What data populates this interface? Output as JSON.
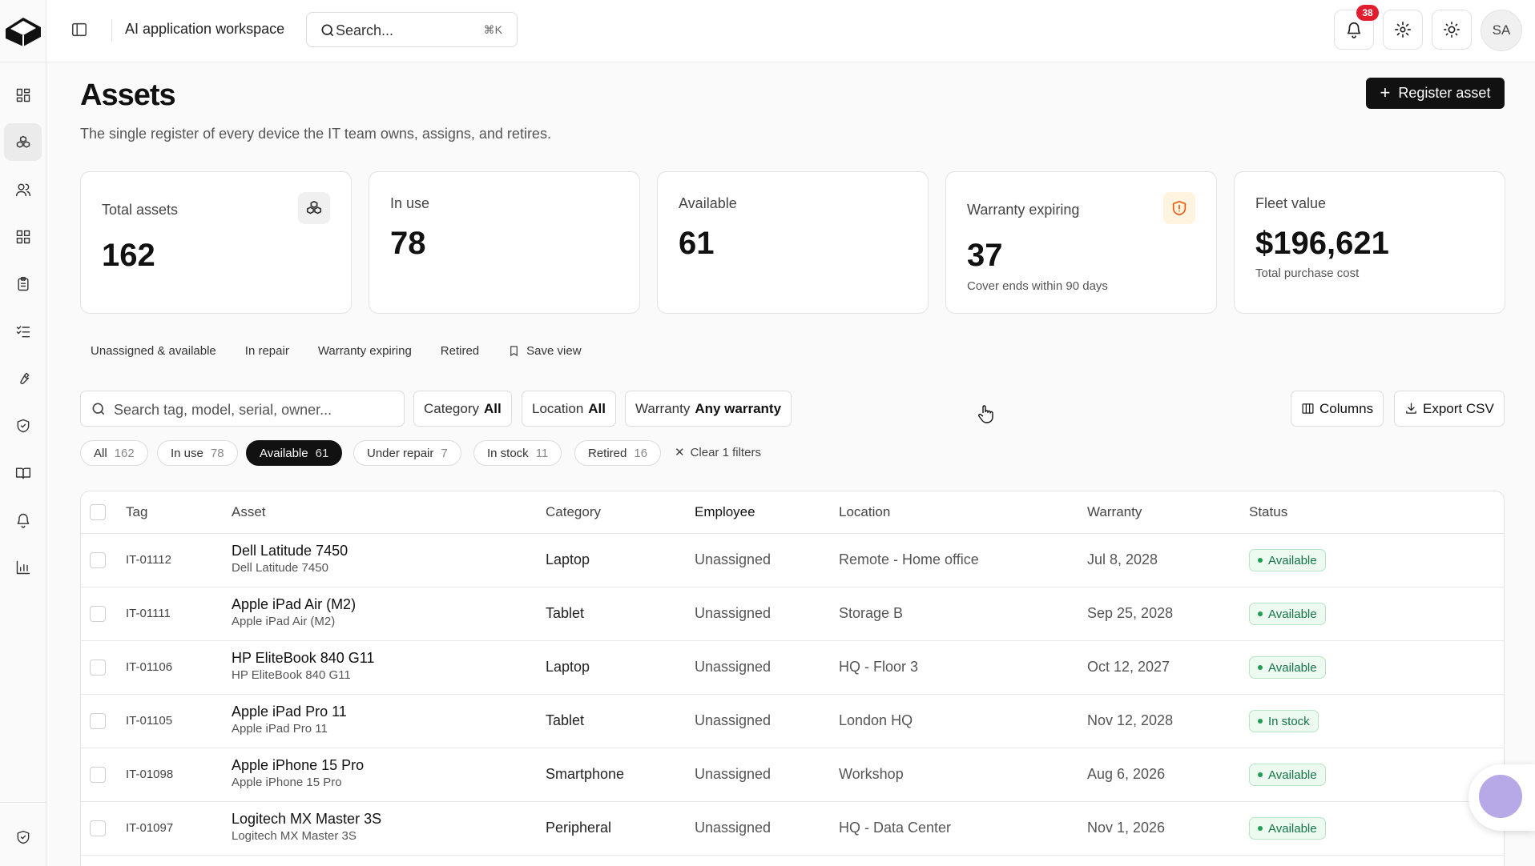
{
  "topbar": {
    "workspace": "AI application workspace",
    "search_placeholder": "Search...",
    "search_shortcut": "⌘K",
    "notification_count": "38",
    "avatar_initials": "SA"
  },
  "header": {
    "title": "Assets",
    "subtitle": "The single register of every device the IT team owns, assigns, and retires.",
    "register_label": "Register asset"
  },
  "stats": {
    "total": {
      "label": "Total assets",
      "value": "162"
    },
    "in_use": {
      "label": "In use",
      "value": "78"
    },
    "available": {
      "label": "Available",
      "value": "61"
    },
    "warranty": {
      "label": "Warranty expiring",
      "value": "37",
      "sub": "Cover ends within 90 days"
    },
    "fleet": {
      "label": "Fleet value",
      "value": "$196,621",
      "sub": "Total purchase cost"
    }
  },
  "views": {
    "unassigned": "Unassigned & available",
    "repair": "In repair",
    "warranty": "Warranty expiring",
    "retired": "Retired",
    "save": "Save view"
  },
  "filters": {
    "search_placeholder": "Search tag, model, serial, owner...",
    "category_label": "Category",
    "category_value": "All",
    "location_label": "Location",
    "location_value": "All",
    "warranty_label": "Warranty",
    "warranty_value": "Any warranty",
    "columns_label": "Columns",
    "export_label": "Export CSV",
    "clear_label": "Clear 1 filters"
  },
  "chips": {
    "all": {
      "label": "All",
      "count": "162"
    },
    "in_use": {
      "label": "In use",
      "count": "78"
    },
    "available": {
      "label": "Available",
      "count": "61"
    },
    "repair": {
      "label": "Under repair",
      "count": "7"
    },
    "stock": {
      "label": "In stock",
      "count": "11"
    },
    "retired": {
      "label": "Retired",
      "count": "16"
    }
  },
  "table": {
    "headers": {
      "tag": "Tag",
      "asset": "Asset",
      "category": "Category",
      "employee": "Employee",
      "location": "Location",
      "warranty": "Warranty",
      "status": "Status"
    },
    "rows": [
      {
        "tag": "IT-01112",
        "name": "Dell Latitude 7450",
        "model": "Dell Latitude 7450",
        "category": "Laptop",
        "employee": "Unassigned",
        "location": "Remote - Home office",
        "warranty": "Jul 8, 2028",
        "status": "Available"
      },
      {
        "tag": "IT-01111",
        "name": "Apple iPad Air (M2)",
        "model": "Apple iPad Air (M2)",
        "category": "Tablet",
        "employee": "Unassigned",
        "location": "Storage B",
        "warranty": "Sep 25, 2028",
        "status": "Available"
      },
      {
        "tag": "IT-01106",
        "name": "HP EliteBook 840 G11",
        "model": "HP EliteBook 840 G11",
        "category": "Laptop",
        "employee": "Unassigned",
        "location": "HQ - Floor 3",
        "warranty": "Oct 12, 2027",
        "status": "Available"
      },
      {
        "tag": "IT-01105",
        "name": "Apple iPad Pro 11",
        "model": "Apple iPad Pro 11",
        "category": "Tablet",
        "employee": "Unassigned",
        "location": "London HQ",
        "warranty": "Nov 12, 2028",
        "status": "In stock"
      },
      {
        "tag": "IT-01098",
        "name": "Apple iPhone 15 Pro",
        "model": "Apple iPhone 15 Pro",
        "category": "Smartphone",
        "employee": "Unassigned",
        "location": "Workshop",
        "warranty": "Aug 6, 2026",
        "status": "Available"
      },
      {
        "tag": "IT-01097",
        "name": "Logitech MX Master 3S",
        "model": "Logitech MX Master 3S",
        "category": "Peripheral",
        "employee": "Unassigned",
        "location": "HQ - Data Center",
        "warranty": "Nov 1, 2026",
        "status": "Available"
      }
    ]
  },
  "colors": {
    "accent": "#111111",
    "success_bg": "#ecfaf0",
    "success_text": "#157347",
    "warning": "#e8590c",
    "badge": "#e11d2e"
  }
}
